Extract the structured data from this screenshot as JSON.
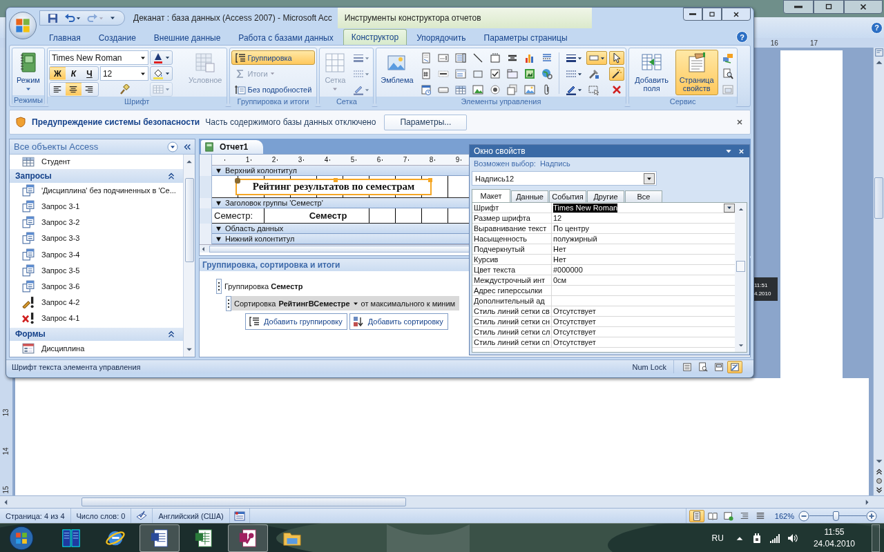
{
  "word_window": {
    "help": "?",
    "ruler": [
      "16",
      "17"
    ],
    "vertical_ruler": [
      "13",
      "14",
      "15"
    ],
    "document_image": [
      "11:51",
      "4.2010"
    ],
    "status_bar": {
      "page": "Страница: 4 из 4",
      "words": "Число слов: 0",
      "language": "Английский (США)",
      "views": [
        {
          "selected": true
        },
        {
          "selected": false
        },
        {
          "selected": false
        },
        {
          "selected": false
        },
        {
          "selected": false
        }
      ],
      "zoom": "162%",
      "zoom_slider": {
        "level": 0.46
      }
    }
  },
  "access_window": {
    "title": "Деканат : база данных (Access 2007)  -  Microsoft Acc",
    "context_title": "Инструменты конструктора отчетов",
    "help": "?",
    "tabs": [
      {
        "label": "Главная",
        "selected": false
      },
      {
        "label": "Создание",
        "selected": false
      },
      {
        "label": "Внешние данные",
        "selected": false
      },
      {
        "label": "Работа с базами данных",
        "selected": false
      },
      {
        "label": "Конструктор",
        "selected": true
      },
      {
        "label": "Упорядочить",
        "selected": false
      },
      {
        "label": "Параметры страницы",
        "selected": false
      }
    ],
    "ribbon": [
      {
        "label": "Режимы",
        "controls": [
          {
            "kind": "big",
            "label": "Режим",
            "dropdown": true,
            "disabled": false,
            "selected": false
          }
        ]
      },
      {
        "label": "Шрифт",
        "controls": [
          {
            "kind": "font_panel",
            "font": "Times New Roman",
            "size": "12",
            "styles": [
              {
                "label": "Ж",
                "selected": true
              },
              {
                "label": "К",
                "selected": false
              },
              {
                "label": "Ч",
                "selected": false
              }
            ],
            "alignment": [
              {
                "selected": false
              },
              {
                "selected": true
              },
              {
                "selected": false
              }
            ],
            "gridlines": {
              "disabled": true
            }
          },
          {
            "kind": "big",
            "label": "Условное",
            "dropdown": false,
            "disabled": true,
            "selected": false
          }
        ]
      },
      {
        "label": "Группировка и итоги",
        "controls": [
          {
            "kind": "small",
            "label": "Группировка",
            "dropdown": false,
            "disabled": false,
            "selected": true
          },
          {
            "kind": "small",
            "label": "Итоги",
            "dropdown": true,
            "disabled": true,
            "selected": false
          },
          {
            "kind": "small",
            "label": "Без подробностей",
            "dropdown": false,
            "disabled": false,
            "selected": false
          }
        ]
      },
      {
        "label": "Сетка",
        "controls": [
          {
            "kind": "big",
            "label": "Сетка",
            "dropdown": true,
            "disabled": true,
            "selected": false
          },
          {
            "kind": "icon_column",
            "disabled": true
          }
        ]
      },
      {
        "label": "Элементы управления",
        "controls": [
          {
            "kind": "big",
            "label": "Эмблема",
            "dropdown": false,
            "disabled": false,
            "selected": false
          },
          {
            "kind": "icon_column"
          },
          {
            "kind": "icon_column"
          },
          {
            "kind": "icon_column"
          },
          {
            "kind": "icon_column"
          },
          {
            "kind": "icon_column"
          },
          {
            "kind": "icon_column"
          },
          {
            "kind": "icon_column"
          },
          {
            "kind": "icon_column"
          },
          {
            "kind": "separator"
          },
          {
            "kind": "icon_column"
          },
          {
            "kind": "icon_column",
            "items": [
              {
                "selected": true
              },
              {
                "selected": false
              },
              {
                "selected": false
              }
            ]
          },
          {
            "kind": "icon_column",
            "items": [
              {
                "selected": true
              },
              {
                "selected": true
              },
              {
                "selected": false
              }
            ]
          }
        ]
      },
      {
        "label": "Сервис",
        "controls": [
          {
            "kind": "big",
            "label": "Добавить поля",
            "dropdown": false,
            "disabled": false,
            "selected": false
          },
          {
            "kind": "big",
            "label": "Страница свойств",
            "dropdown": false,
            "disabled": false,
            "selected": true
          },
          {
            "kind": "icon_column"
          }
        ]
      }
    ],
    "security_bar": {
      "title": "Предупреждение системы безопасности",
      "message": "Часть содержимого базы данных отключено",
      "button": "Параметры..."
    },
    "nav_pane": {
      "title": "Все объекты Access",
      "items": [
        {
          "kind": "table",
          "label": "Студент"
        },
        {
          "kind": "group",
          "label": "Запросы",
          "expanded": true
        },
        {
          "kind": "query",
          "label": "'Дисциплина' без подчиненных в 'Се..."
        },
        {
          "kind": "query",
          "label": "Запрос 3-1"
        },
        {
          "kind": "query",
          "label": "Запрос 3-2"
        },
        {
          "kind": "query",
          "label": "Запрос 3-3"
        },
        {
          "kind": "query",
          "label": "Запрос 3-4"
        },
        {
          "kind": "query",
          "label": "Запрос 3-5"
        },
        {
          "kind": "query",
          "label": "Запрос 3-6"
        },
        {
          "kind": "update_query",
          "label": "Запрос 4-2"
        },
        {
          "kind": "delete_query",
          "label": "Запрос 4-1"
        },
        {
          "kind": "group",
          "label": "Формы",
          "expanded": true
        },
        {
          "kind": "form",
          "label": "Дисциплина"
        }
      ]
    },
    "document": {
      "tab": "Отчет1",
      "ruler": [
        "1",
        "2",
        "3",
        "4",
        "5",
        "6",
        "7",
        "8",
        "9"
      ],
      "sections": [
        {
          "label": "Верхний колонтитул",
          "controls": [
            {
              "kind": "label",
              "text": "Рейтинг результатов по семестрам",
              "selected": true
            }
          ]
        },
        {
          "label": "Заголовок группы 'Семестр'",
          "controls": [
            {
              "kind": "label",
              "text": "Семестр:",
              "selected": false
            },
            {
              "kind": "textbox",
              "text": "Семестр",
              "selected": false
            }
          ]
        },
        {
          "label": "Область данных"
        },
        {
          "label": "Нижний колонтитул"
        }
      ],
      "grouping": {
        "title": "Группировка, сортировка и итоги",
        "group": {
          "label": "Группировка",
          "field": "Семестр"
        },
        "sort": {
          "label": "Сортировка",
          "field": "РейтингВСеместре",
          "order": "от максимального к миним"
        },
        "buttons": [
          "Добавить группировку",
          "Добавить сортировку"
        ]
      }
    },
    "property_sheet": {
      "title": "Окно свойств",
      "selection_label": "Возможен выбор:",
      "selection_type": "Надпись",
      "object": "Надпись12",
      "tabs": [
        {
          "label": "Макет",
          "selected": true
        },
        {
          "label": "Данные",
          "selected": false
        },
        {
          "label": "События",
          "selected": false
        },
        {
          "label": "Другие",
          "selected": false
        },
        {
          "label": "Все",
          "selected": false
        }
      ],
      "rows": [
        {
          "name": "Шрифт",
          "value": "Times New Roman",
          "selected": true
        },
        {
          "name": "Размер шрифта",
          "value": "12",
          "selected": false
        },
        {
          "name": "Выравнивание текст",
          "value": "По центру",
          "selected": false
        },
        {
          "name": "Насыщенность",
          "value": "полужирный",
          "selected": false
        },
        {
          "name": "Подчеркнутый",
          "value": "Нет",
          "selected": false
        },
        {
          "name": "Курсив",
          "value": "Нет",
          "selected": false
        },
        {
          "name": "Цвет текста",
          "value": "#000000",
          "selected": false
        },
        {
          "name": "Междустрочный инт",
          "value": "0см",
          "selected": false
        },
        {
          "name": "Адрес гиперссылки",
          "selected": false
        },
        {
          "name": "Дополнительный ад",
          "selected": false
        },
        {
          "name": "Стиль линий сетки св",
          "value": "Отсутствует",
          "selected": false
        },
        {
          "name": "Стиль линий сетки сн",
          "value": "Отсутствует",
          "selected": false
        },
        {
          "name": "Стиль линий сетки сл",
          "value": "Отсутствует",
          "selected": false
        },
        {
          "name": "Стиль линий сетки сп",
          "value": "Отсутствует",
          "selected": false
        }
      ]
    },
    "status_bar": {
      "text": "Шрифт текста элемента управления",
      "num_lock": "Num Lock",
      "views": [
        {
          "selected": false
        },
        {
          "selected": false
        },
        {
          "selected": false
        },
        {
          "selected": true
        }
      ]
    }
  },
  "taskbar": {
    "apps": [
      {
        "kind": "servers",
        "active": false
      },
      {
        "kind": "browser",
        "active": false
      },
      {
        "kind": "word",
        "active": true
      },
      {
        "kind": "excel",
        "active": false
      },
      {
        "kind": "access",
        "active": true
      },
      {
        "kind": "folder",
        "active": false
      }
    ],
    "language": "RU",
    "time": "11:55",
    "date": "24.04.2010"
  }
}
